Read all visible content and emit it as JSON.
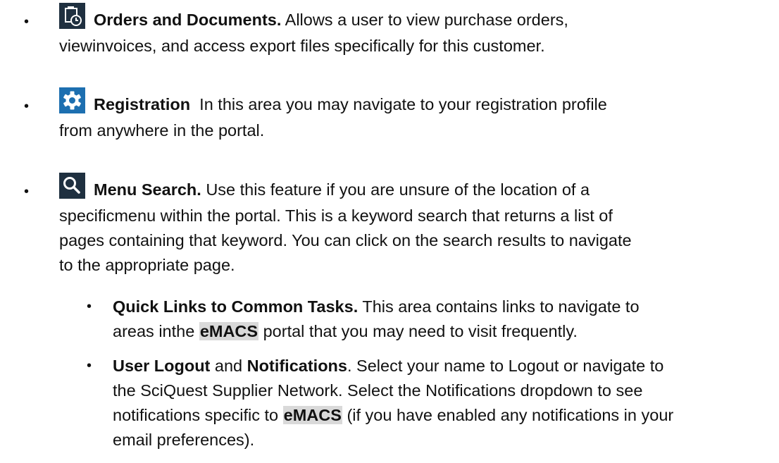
{
  "items": [
    {
      "icon": "orders-documents-icon",
      "title": "Orders and Documents.",
      "body": " Allows a user to view purchase orders,",
      "body2": "viewinvoices, and access export files specifically for this customer."
    },
    {
      "icon": "gear-icon",
      "title": "Registration",
      "body": "  In this area you may navigate to your registration profile",
      "body2": "from anywhere in the portal."
    },
    {
      "icon": "search-icon",
      "title": "Menu Search.",
      "body": " Use this feature if you are unsure of the location of a",
      "body2": "specificmenu within the portal. This is a keyword search that returns a list of",
      "body3": "pages containing that keyword. You can click on the search results to navigate",
      "body4": "to the appropriate page."
    }
  ],
  "subitems": [
    {
      "title": "Quick Links to Common Tasks.",
      "body": " This area contains links to navigate to",
      "body2_pre": "areas inthe ",
      "highlight": "eMACS",
      "body2_post": " portal that you may need to visit frequently."
    },
    {
      "title": "User Logout",
      "and": " and ",
      "title2": "Notifications",
      "body": ". Select your name to Logout or navigate to",
      "body2": "the SciQuest Supplier Network. Select the Notifications dropdown to see",
      "body3_pre": "notifications specific to ",
      "highlight": "eMACS",
      "body3_post": " (if you have enabled any notifications in your",
      "body4": "email preferences)."
    }
  ],
  "bullet_char": "•"
}
